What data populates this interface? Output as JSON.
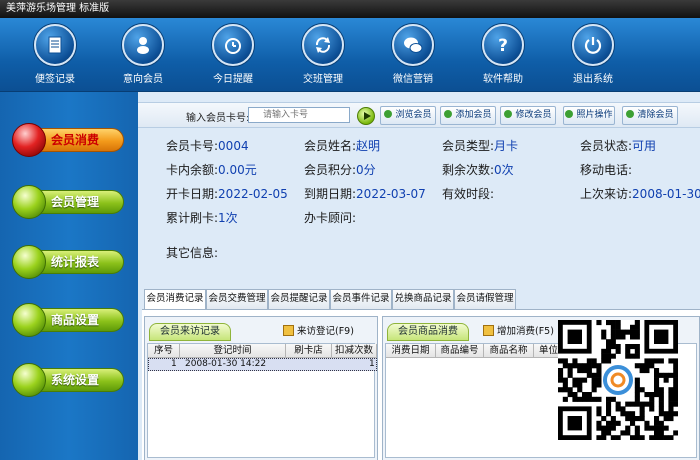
{
  "window": {
    "title": "美萍游乐场管理 标准版"
  },
  "toolbar": [
    {
      "label": "便签记录",
      "icon": "note-icon"
    },
    {
      "label": "意向会员",
      "icon": "person-icon"
    },
    {
      "label": "今日提醒",
      "icon": "alarm-clock-icon"
    },
    {
      "label": "交班管理",
      "icon": "refresh-icon"
    },
    {
      "label": "微信营销",
      "icon": "wechat-icon"
    },
    {
      "label": "软件帮助",
      "icon": "help-icon"
    },
    {
      "label": "退出系统",
      "icon": "power-icon"
    }
  ],
  "sidebar": [
    {
      "label": "会员消费",
      "active": true
    },
    {
      "label": "会员管理",
      "active": false
    },
    {
      "label": "统计报表",
      "active": false
    },
    {
      "label": "商品设置",
      "active": false
    },
    {
      "label": "系统设置",
      "active": false
    }
  ],
  "search": {
    "label": "输入会员卡号:",
    "placeholder": "请输入卡号",
    "buttons": [
      "浏览会员",
      "添加会员",
      "修改会员",
      "照片操作",
      "清除会员"
    ]
  },
  "member": {
    "card_no_label": "会员卡号:",
    "card_no": "0004",
    "name_label": "会员姓名:",
    "name": "赵明",
    "type_label": "会员类型:",
    "type": "月卡",
    "status_label": "会员状态:",
    "status": "可用",
    "balance_label": "卡内余额:",
    "balance": "0.00元",
    "points_label": "会员积分:",
    "points": "0分",
    "remaining_label": "剩余次数:",
    "remaining": "0次",
    "phone_label": "移动电话:",
    "phone": "",
    "open_date_label": "开卡日期:",
    "open_date": "2022-02-05",
    "expire_date_label": "到期日期:",
    "expire_date": "2022-03-07",
    "valid_period_label": "有效时段:",
    "valid_period": "",
    "last_visit_label": "上次来访:",
    "last_visit": "2008-01-30",
    "swipes_label": "累计刷卡:",
    "swipes": "1次",
    "consultant_label": "办卡顾问:",
    "consultant": "",
    "other_label": "其它信息:"
  },
  "tabs": [
    "会员消费记录",
    "会员交费管理",
    "会员提醒记录",
    "会员事件记录",
    "兑换商品记录",
    "会员请假管理"
  ],
  "visits": {
    "title": "会员来访记录",
    "action": "来访登记(F9)",
    "columns": [
      "序号",
      "登记时间",
      "刷卡店",
      "扣减次数"
    ],
    "rows": [
      {
        "no": "1",
        "time": "2008-01-30 14:22",
        "store": "",
        "deduct": "1"
      }
    ]
  },
  "goods": {
    "title": "会员商品消费",
    "action": "增加消费(F5)",
    "columns": [
      "消费日期",
      "商品编号",
      "商品名称",
      "单位"
    ]
  }
}
